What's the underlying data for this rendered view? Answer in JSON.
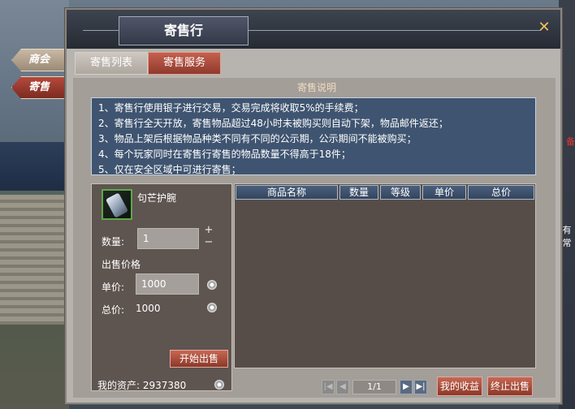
{
  "window": {
    "title": "寄售行",
    "close_icon": "close-x-icon"
  },
  "side_tabs": [
    {
      "label": "商会"
    },
    {
      "label": "寄售"
    }
  ],
  "tabs": [
    {
      "label": "寄售列表",
      "active": false
    },
    {
      "label": "寄售服务",
      "active": true
    }
  ],
  "description": {
    "header": "寄售说明",
    "lines": [
      "1、寄售行使用银子进行交易，交易完成将收取5%的手续费；",
      "2、寄售行全天开放，寄售物品超过48小时未被购买则自动下架，物品邮件返还；",
      "3、物品上架后根据物品种类不同有不同的公示期，公示期间不能被购买；",
      "4、每个玩家同时在寄售行寄售的物品数量不得高于18件；",
      "5、仅在安全区域中可进行寄售；"
    ]
  },
  "sell_panel": {
    "item_name": "句芒护腕",
    "quantity_label": "数量:",
    "quantity_value": "1",
    "plus": "+",
    "minus": "−",
    "price_title": "出售价格",
    "unit_price_label": "单价:",
    "unit_price_value": "1000",
    "total_label": "总价:",
    "total_value": "1000",
    "start_button": "开始出售"
  },
  "list_panel": {
    "columns": [
      "商品名称",
      "数量",
      "等级",
      "单价",
      "总价"
    ],
    "rows": []
  },
  "footer": {
    "assets_label": "我的资产: 2937380",
    "page_indicator": "1/1",
    "earnings_button": "我的收益",
    "stop_button": "终止出售"
  },
  "background": {
    "right_text_1": "有",
    "right_text_2": "常",
    "right_red": "备"
  },
  "colors": {
    "accent_red": "#8c3828",
    "desc_bg": "#3f5470",
    "header_bar": "#34455e"
  }
}
